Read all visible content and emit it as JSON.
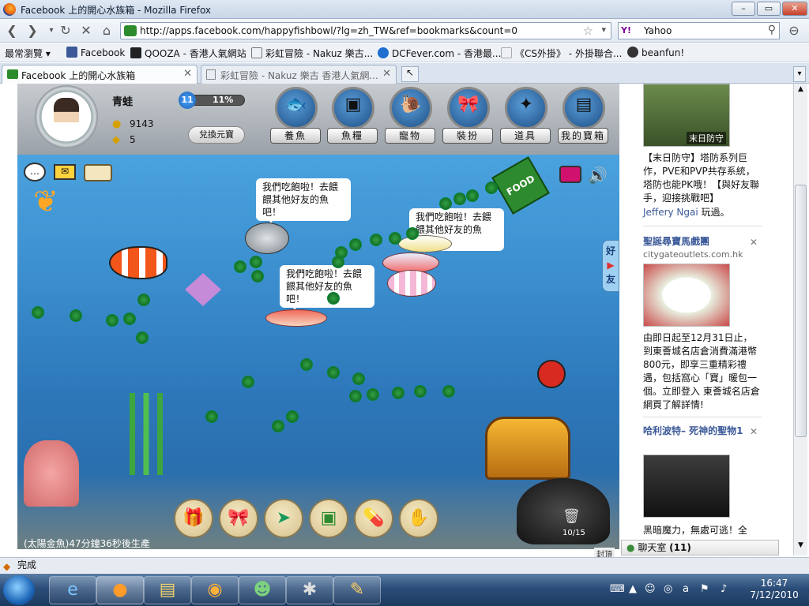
{
  "window": {
    "title": "Facebook 上的開心水族箱 - Mozilla Firefox",
    "min": "–",
    "max": "▭",
    "close": "✕"
  },
  "nav": {
    "url": "http://apps.facebook.com/happyfishbowl/?lg=zh_TW&ref=bookmarks&count=0",
    "search_engine": "Y!",
    "search_value": "Yahoo"
  },
  "bookmarks": [
    {
      "label": "最常瀏覽 ▾",
      "color": "#eef2f7"
    },
    {
      "label": "Facebook",
      "color": "#3b5998"
    },
    {
      "label": "QOOZA - 香港人氣網站",
      "color": "#222222"
    },
    {
      "label": "彩虹冒險 - Nakuz 樂古...",
      "color": "#ffffff"
    },
    {
      "label": "DCFever.com - 香港最...",
      "color": "#1e6fd0"
    },
    {
      "label": "《CS外掛》 - 外掛聯合...",
      "color": "#dddddd"
    },
    {
      "label": "beanfun!",
      "color": "#333333"
    }
  ],
  "tabs": [
    {
      "label": "Facebook 上的開心水族箱",
      "close": "✕"
    },
    {
      "label": "彩虹冒險 - Nakuz 樂古 香港人氣網...",
      "close": "✕"
    }
  ],
  "hud": {
    "username": "青蛙",
    "coins": "9143",
    "gold": "5",
    "level": "11",
    "exp_percent": "11%",
    "exp_fraction": 0.11,
    "redeem": "兌換元寶",
    "buttons": [
      {
        "label": "養魚",
        "icon": "fish"
      },
      {
        "label": "魚糧",
        "icon": "food"
      },
      {
        "label": "寵物",
        "icon": "snail"
      },
      {
        "label": "裝扮",
        "icon": "bow"
      },
      {
        "label": "道具",
        "icon": "wand"
      },
      {
        "label": "我的寶箱",
        "icon": "chest"
      }
    ]
  },
  "bubbles": [
    {
      "text": "我們吃飽啦！去餵餵其他好友的魚吧！"
    },
    {
      "text": "我們吃飽啦！去餵餵其他好友的魚吧！"
    },
    {
      "text": "我們吃飽啦！去餵餵其他好友的魚吧！"
    }
  ],
  "side_tab": {
    "line1": "好",
    "line2": "▶",
    "line3": "友"
  },
  "food_label": "FOOD",
  "trash_count": "10/15",
  "status_text": "(太陽金魚)47分鐘36秒後生產",
  "corner_label": "封頂",
  "sidebar": {
    "ad1": {
      "caption": "末日防守",
      "desc": "【末日防守】塔防系列巨作，PVE和PVP共存系統，塔防也能PK哦！【與好友聯手，迎接挑戰吧】",
      "user": "Jeffery Ngai",
      "played": "玩過。"
    },
    "ad2": {
      "title": "聖誕尋寶馬戲團",
      "domain": "citygateoutlets.com.hk",
      "desc": "由即日起至12月31日止，到東薈城名店倉消費滿港幣800元，即享三重精彩禮遇，包括窩心「寶」暖包一個。立即登入 東薈城名店倉網頁了解詳情!"
    },
    "ad3": {
      "title": "哈利波特– 死神的聖物1",
      "desc": "黑暗魔力，無處可逃！全"
    },
    "close": "✕"
  },
  "chat": {
    "label": "聊天室",
    "count": "(11)"
  },
  "firefox_status": "完成",
  "taskbar": {
    "time": "16:47",
    "date": "7/12/2010"
  }
}
